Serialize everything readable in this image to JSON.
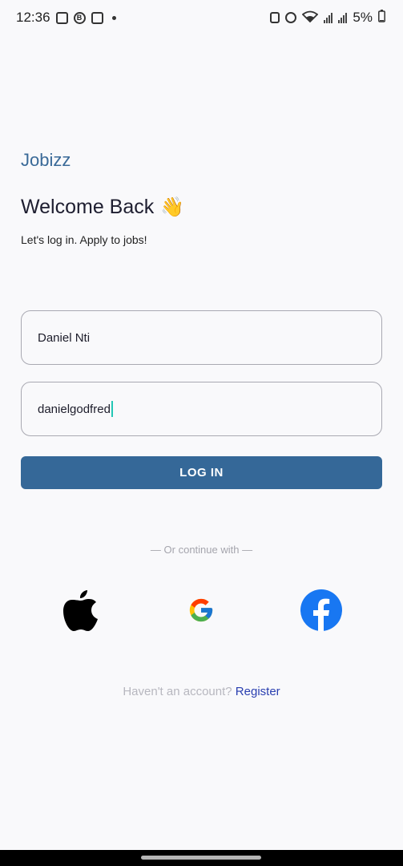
{
  "status_bar": {
    "time": "12:36",
    "battery": "5%",
    "left_icons": [
      "gallery-icon",
      "b-badge-icon",
      "instagram-icon",
      "dot-icon"
    ],
    "right_icons": [
      "lock-icon",
      "alarm-icon",
      "wifi-icon",
      "signal-icon",
      "signal-icon"
    ]
  },
  "brand": "Jobizz",
  "welcome": {
    "title": "Welcome Back",
    "emoji": "👋",
    "subtitle": "Let's log in. Apply to jobs!"
  },
  "form": {
    "name_value": "Daniel Nti",
    "password_value": "danielgodfred",
    "login_label": "LOG IN"
  },
  "divider_text": "— Or continue with —",
  "social": [
    {
      "name": "apple",
      "icon": "apple-icon"
    },
    {
      "name": "google",
      "icon": "google-icon"
    },
    {
      "name": "facebook",
      "icon": "facebook-icon",
      "color": "#1877f2"
    }
  ],
  "register": {
    "question": "Haven't an account?",
    "link": "Register"
  },
  "colors": {
    "brand": "#3a6a98",
    "primary_button": "#356898",
    "link": "#2a3fb0",
    "background": "#f9f9fb"
  }
}
